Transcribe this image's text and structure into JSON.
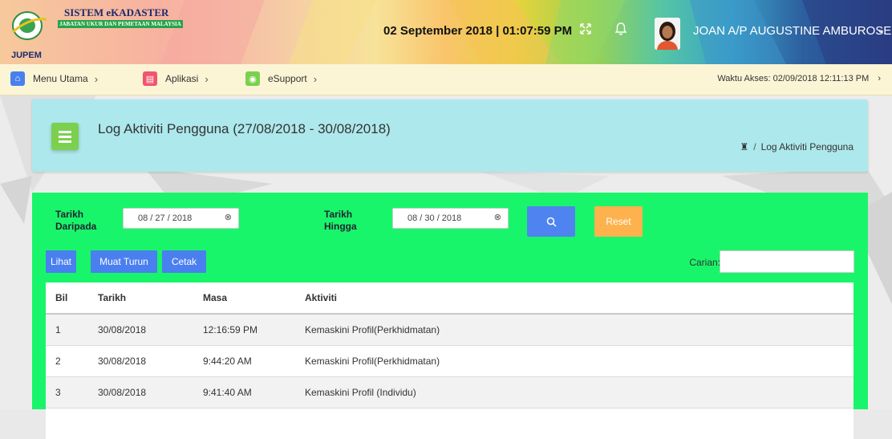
{
  "header": {
    "brand_title": "SISTEM eKADASTER",
    "brand_subtitle": "JABATAN UKUR DAN PEMETAAN MALAYSIA",
    "logo_text": "JUPEM",
    "datetime": "02 September 2018 | 01:07:59 PM",
    "fullscreen_icon": "expand-icon",
    "notification_icon": "bell-icon",
    "user_name": "JOAN A/P AUGUSTINE AMBUROSE"
  },
  "nav": {
    "items": [
      {
        "label": "Menu Utama",
        "icon": "home-icon",
        "color": "#4a7ff0"
      },
      {
        "label": "Aplikasi",
        "icon": "apps-icon",
        "color": "#f0556e"
      },
      {
        "label": "eSupport",
        "icon": "support-icon",
        "color": "#7bd04e"
      }
    ],
    "access_time": "Waktu Akses: 02/09/2018 12:11:13 PM"
  },
  "page": {
    "title": "Log Aktiviti Pengguna (27/08/2018 - 30/08/2018)",
    "breadcrumb_current": "Log Aktiviti Pengguna",
    "breadcrumb_sep": "/"
  },
  "filter": {
    "from_label_1": "Tarikh",
    "from_label_2": "Daripada",
    "from_value": "08 / 27 / 2018",
    "to_label_1": "Tarikh",
    "to_label_2": "Hingga",
    "to_value": "08 / 30 / 2018",
    "reset_label": "Reset"
  },
  "toolbar": {
    "view_label": "Lihat",
    "download_label": "Muat Turun",
    "print_label": "Cetak",
    "search_label": "Carian:",
    "search_value": ""
  },
  "table": {
    "headers": [
      "Bil",
      "Tarikh",
      "Masa",
      "Aktiviti"
    ],
    "rows": [
      [
        "1",
        "30/08/2018",
        "12:16:59 PM",
        "Kemaskini Profil(Perkhidmatan)"
      ],
      [
        "2",
        "30/08/2018",
        "9:44:20 AM",
        "Kemaskini Profil(Perkhidmatan)"
      ],
      [
        "3",
        "30/08/2018",
        "9:41:40 AM",
        "Kemaskini Profil (Individu)"
      ],
      [
        "",
        "",
        "",
        ""
      ]
    ]
  },
  "colors": {
    "accent_blue": "#4a7ff0",
    "title_card": "#ade8ec",
    "content_green": "#19f56a",
    "reset_orange": "#fdb24d",
    "nav_bg": "#fbf5d6"
  }
}
